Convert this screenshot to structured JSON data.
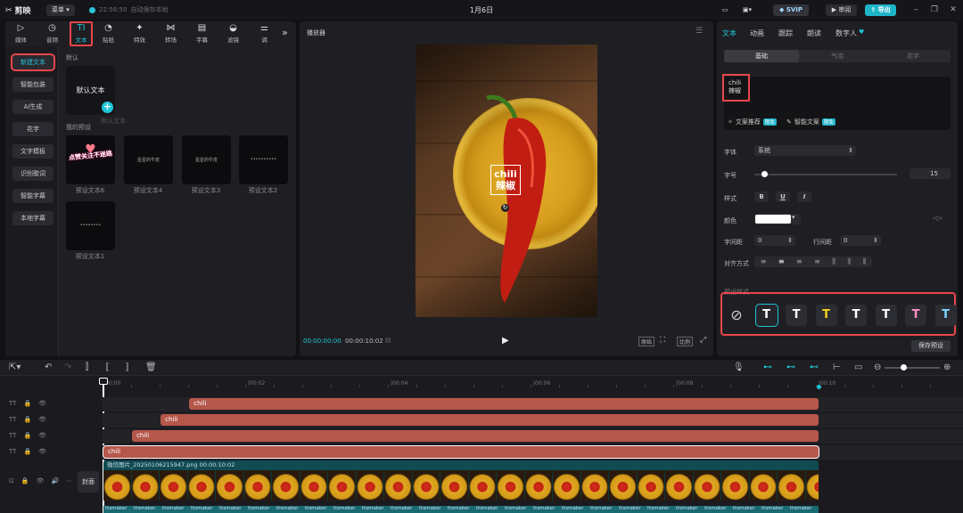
{
  "app": {
    "name": "剪映",
    "menu_label": "菜单",
    "save_time": "22:56:50",
    "save_status": "自动保存本地",
    "title": "1月6日"
  },
  "toolbar": {
    "svip": "SVIP",
    "review": "审阅",
    "export": "导出"
  },
  "media_tabs": [
    {
      "label": "媒体",
      "icon": "media-icon"
    },
    {
      "label": "音频",
      "icon": "audio-icon"
    },
    {
      "label": "文本",
      "icon": "text-icon"
    },
    {
      "label": "贴纸",
      "icon": "sticker-icon"
    },
    {
      "label": "特效",
      "icon": "effects-icon"
    },
    {
      "label": "转场",
      "icon": "transition-icon"
    },
    {
      "label": "字幕",
      "icon": "subtitle-icon"
    },
    {
      "label": "滤镜",
      "icon": "filter-icon"
    },
    {
      "label": "调",
      "icon": "adjust-icon"
    }
  ],
  "text_sidebar": [
    "新建文本",
    "智能包装",
    "AI生成",
    "花字",
    "文字模板",
    "识别歌词",
    "智能字幕",
    "本地字幕"
  ],
  "library": {
    "default_label": "默认",
    "default_card": "默认文本",
    "default_card_caption": "默认文本",
    "my_presets_label": "我的预设",
    "presets": [
      {
        "caption": "预设文本6",
        "thumb": "点赞关注不迷路"
      },
      {
        "caption": "预设文本4",
        "thumb": "星星的牛皮"
      },
      {
        "caption": "预设文本3",
        "thumb": "星星的牛皮"
      },
      {
        "caption": "预设文本2",
        "thumb": "••••••••••"
      },
      {
        "caption": "预设文本1",
        "thumb": "••••••••"
      }
    ]
  },
  "player": {
    "title": "播放器",
    "overlay_line1": "chili",
    "overlay_line2": "辣椒",
    "current_time": "00:00:00:00",
    "total_time": "00:00:10:02",
    "btn_original": "原始",
    "btn_ratio": "比例"
  },
  "inspector": {
    "tabs": [
      "文本",
      "动画",
      "跟踪",
      "朗读",
      "数字人"
    ],
    "segments": [
      "基础",
      "气泡",
      "花字"
    ],
    "text_content_line1": "chili",
    "text_content_line2": "辣椒",
    "recommend_label": "文案推荐",
    "recommend_badge": "限免",
    "smart_copy_label": "智能文案",
    "smart_copy_badge": "限免",
    "font_label": "字体",
    "font_value": "系统",
    "size_label": "字号",
    "size_value": "15",
    "size_level": 0.05,
    "style_label": "样式",
    "style_buttons": [
      "B",
      "U",
      "I"
    ],
    "color_label": "颜色",
    "color_value": "#ffffff",
    "spacing_label": "字间距",
    "spacing_value": "0",
    "line_spacing_label": "行间距",
    "line_spacing_value": "0",
    "align_label": "对齐方式",
    "preset_style_label": "预设样式",
    "preset_styles": [
      {
        "glyph": "",
        "color": "#d0d0d0",
        "kind": "none-icon"
      },
      {
        "glyph": "T",
        "color": "#ffffff"
      },
      {
        "glyph": "T",
        "color": "#ffffff"
      },
      {
        "glyph": "T",
        "color": "#f2d01e"
      },
      {
        "glyph": "T",
        "color": "#ffffff"
      },
      {
        "glyph": "T",
        "color": "#ffffff"
      },
      {
        "glyph": "T",
        "color": "#ff8fc1"
      },
      {
        "glyph": "T",
        "color": "#7fd3ff"
      }
    ],
    "save_preset": "保存预设"
  },
  "timeline": {
    "ruler": [
      "00:00",
      "|00:02",
      "|00:04",
      "|00:06",
      "|00:08",
      "|00:10"
    ],
    "cover_label": "封面",
    "text_clips": [
      {
        "label": "chili",
        "start": 0.12,
        "end": 1.0
      },
      {
        "label": "chili",
        "start": 0.08,
        "end": 1.0
      },
      {
        "label": "chili",
        "start": 0.04,
        "end": 1.0
      },
      {
        "label": "chili",
        "start": 0.0,
        "end": 1.0
      }
    ],
    "video_clip_name": "微信图片_20250106215947.png",
    "video_clip_duration": "00:00:10:02",
    "audio_label": "ttsmaker"
  },
  "colors": {
    "accent": "#1fc5d6",
    "highlight": "#e8464a",
    "clip": "#b5574a"
  }
}
